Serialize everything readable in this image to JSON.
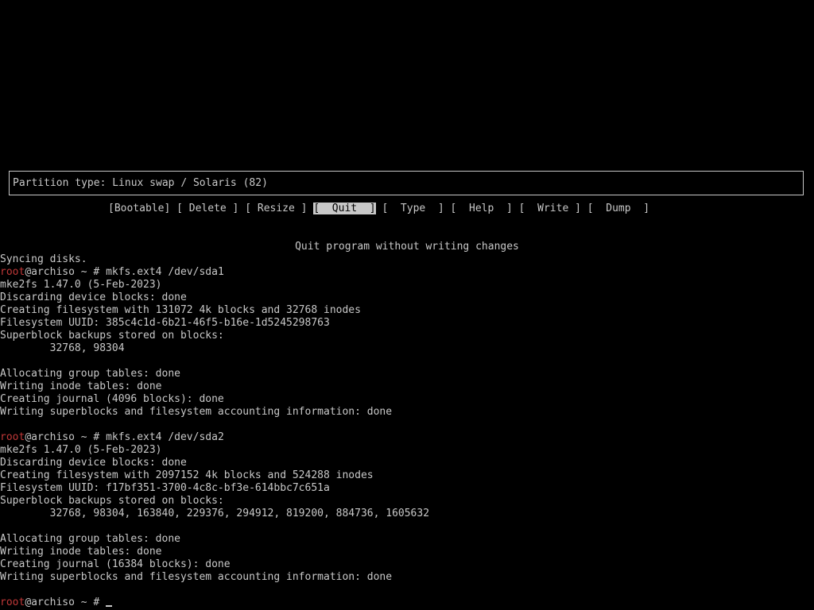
{
  "partition": {
    "type_text": "Partition type: Linux swap / Solaris (82)"
  },
  "menu": {
    "items": [
      {
        "label": "[Bootable]",
        "selected": false
      },
      {
        "label": "[ Delete ]",
        "selected": false
      },
      {
        "label": "[ Resize ]",
        "selected": false
      },
      {
        "label": "[  Quit  ]",
        "selected": true
      },
      {
        "label": "[  Type  ]",
        "selected": false
      },
      {
        "label": "[  Help  ]",
        "selected": false
      },
      {
        "label": "[  Write ]",
        "selected": false
      },
      {
        "label": "[  Dump  ]",
        "selected": false
      }
    ],
    "status": "Quit program without writing changes"
  },
  "terminal": {
    "prompt_user": "root",
    "prompt_rest": "@archiso ~ # ",
    "lines": [
      "Syncing disks.",
      "",
      "mke2fs 1.47.0 (5-Feb-2023)",
      "Discarding device blocks: done",
      "Creating filesystem with 131072 4k blocks and 32768 inodes",
      "Filesystem UUID: 385c4c1d-6b21-46f5-b16e-1d5245298763",
      "Superblock backups stored on blocks:",
      "        32768, 98304",
      "",
      "Allocating group tables: done",
      "Writing inode tables: done",
      "Creating journal (4096 blocks): done",
      "Writing superblocks and filesystem accounting information: done",
      "",
      "",
      "mke2fs 1.47.0 (5-Feb-2023)",
      "Discarding device blocks: done",
      "Creating filesystem with 2097152 4k blocks and 524288 inodes",
      "Filesystem UUID: f17bf351-3700-4c8c-bf3e-614bbc7c651a",
      "Superblock backups stored on blocks:",
      "        32768, 98304, 163840, 229376, 294912, 819200, 884736, 1605632",
      "",
      "Allocating group tables: done",
      "Writing inode tables: done",
      "Creating journal (16384 blocks): done",
      "Writing superblocks and filesystem accounting information: done",
      "",
      ""
    ],
    "commands": {
      "cmd1": "mkfs.ext4 /dev/sda1",
      "cmd2": "mkfs.ext4 /dev/sda2",
      "cmd3": ""
    }
  }
}
